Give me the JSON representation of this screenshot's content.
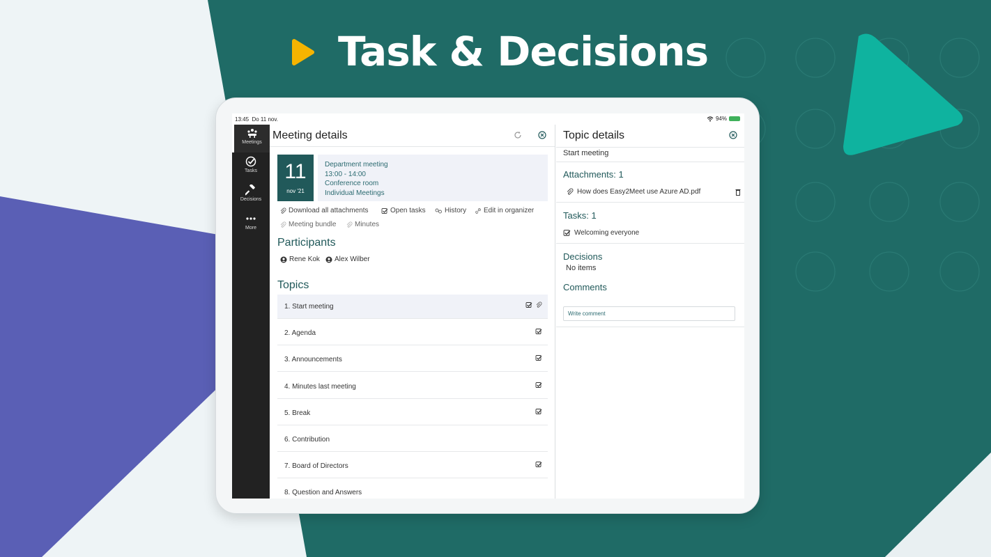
{
  "hero": {
    "title": "Task & Decisions"
  },
  "colors": {
    "teal_bg": "#1f6b66",
    "purple_bg": "#5960b8",
    "accent_teal": "#0fb39f",
    "play_yellow": "#f5b400",
    "brand_dark": "#21595a"
  },
  "statusbar": {
    "time": "13:45",
    "date": "Do 11 nov.",
    "battery": "94%"
  },
  "sidebar": {
    "items": [
      {
        "label": "Meetings",
        "icon": "meetings-icon"
      },
      {
        "label": "Tasks",
        "icon": "task-check-icon"
      },
      {
        "label": "Decisions",
        "icon": "gavel-icon"
      },
      {
        "label": "More",
        "icon": "more-dots-icon"
      }
    ]
  },
  "meeting": {
    "header": "Meeting details",
    "day": "11",
    "month": "nov '21",
    "name": "Department meeting",
    "time": "13:00 - 14:00",
    "location": "Conference room",
    "type": "Individual Meetings",
    "actions": [
      "Download all attachments",
      "Open tasks",
      "History",
      "Edit in organizer",
      "Meeting bundle",
      "Minutes"
    ],
    "participants_title": "Participants",
    "participants": [
      "Rene Kok",
      "Alex Wilber"
    ],
    "topics_title": "Topics",
    "topics": [
      {
        "label": "1. Start meeting",
        "checked": true,
        "attachment": true
      },
      {
        "label": "2. Agenda",
        "checked": true,
        "attachment": false
      },
      {
        "label": "3. Announcements",
        "checked": true,
        "attachment": false
      },
      {
        "label": "4. Minutes last meeting",
        "checked": true,
        "attachment": false
      },
      {
        "label": "5. Break",
        "checked": true,
        "attachment": false
      },
      {
        "label": "6. Contribution",
        "checked": false,
        "attachment": false
      },
      {
        "label": "7. Board of Directors",
        "checked": true,
        "attachment": false
      },
      {
        "label": "8. Question and Answers",
        "checked": false,
        "attachment": false
      }
    ]
  },
  "topic": {
    "header": "Topic details",
    "name": "Start meeting",
    "attachments_title": "Attachments: 1",
    "attachment_file": "How does Easy2Meet use Azure AD.pdf",
    "tasks_title": "Tasks: 1",
    "task": "Welcoming everyone",
    "decisions_title": "Decisions",
    "decisions_empty": "No items",
    "comments_title": "Comments",
    "comment_placeholder": "Write comment"
  }
}
